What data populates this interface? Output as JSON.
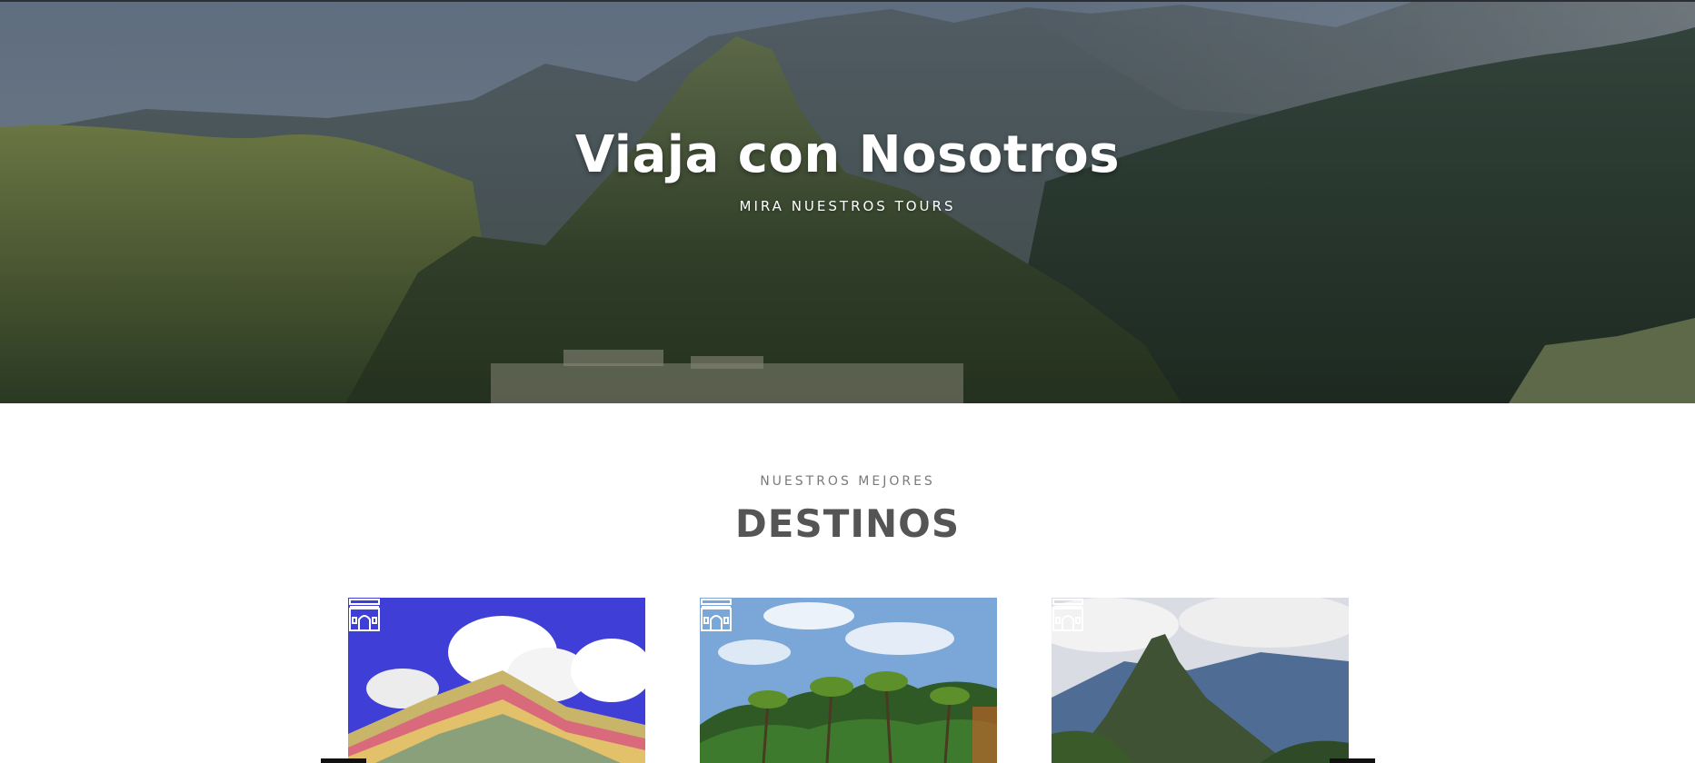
{
  "hero": {
    "title": "Viaja con Nosotros",
    "subtitle": "MIRA NUESTROS TOURS"
  },
  "section": {
    "kicker": "NUESTROS MEJORES",
    "title": "DESTINOS"
  },
  "cards": [
    {
      "image": "rainbow-mountain",
      "icon": "monument-arch-icon"
    },
    {
      "image": "palm-forest",
      "icon": "monument-arch-icon"
    },
    {
      "image": "huayna-picchu",
      "icon": "monument-arch-icon"
    }
  ],
  "colors": {
    "title_dark": "#555555",
    "kicker_gray": "#7a7a7a",
    "white": "#ffffff"
  }
}
